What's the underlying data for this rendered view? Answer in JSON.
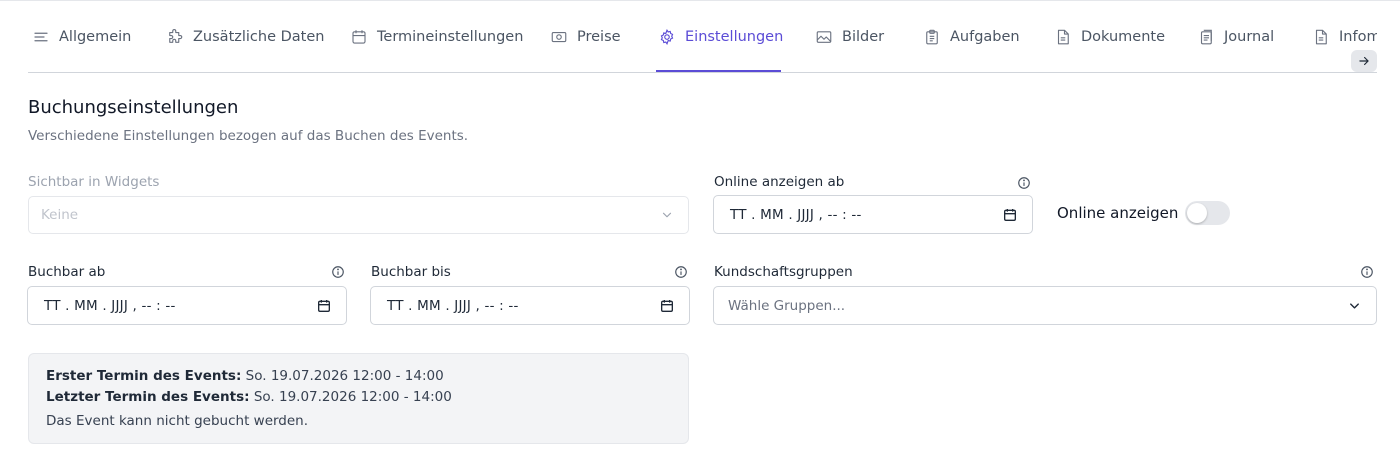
{
  "tabs": [
    {
      "label": "Allgemein",
      "icon": "menu-lines-icon"
    },
    {
      "label": "Zusätzliche Daten",
      "icon": "puzzle-icon"
    },
    {
      "label": "Termineinstellungen",
      "icon": "calendar-icon"
    },
    {
      "label": "Preise",
      "icon": "banknote-icon"
    },
    {
      "label": "Einstellungen",
      "icon": "gear-icon",
      "active": true
    },
    {
      "label": "Bilder",
      "icon": "image-icon"
    },
    {
      "label": "Aufgaben",
      "icon": "clipboard-icon"
    },
    {
      "label": "Dokumente",
      "icon": "document-icon"
    },
    {
      "label": "Journal",
      "icon": "journal-icon"
    },
    {
      "label": "Infom",
      "icon": "info-document-icon"
    }
  ],
  "colors": {
    "accent": "#5b4cd6",
    "infobox_bg": "#f3f4f6"
  },
  "section": {
    "title": "Buchungseinstellungen",
    "subtitle": "Verschiedene Einstellungen bezogen auf das Buchen des Events."
  },
  "fields": {
    "widgets": {
      "label": "Sichtbar in Widgets",
      "placeholder": "Keine"
    },
    "online_from": {
      "label": "Online anzeigen ab",
      "value": "TT . MM . JJJJ ,  -- : --"
    },
    "online_toggle": {
      "label": "Online anzeigen",
      "checked": false
    },
    "bookable_from": {
      "label": "Buchbar ab",
      "value": "TT . MM . JJJJ ,  -- : --"
    },
    "bookable_until": {
      "label": "Buchbar bis",
      "value": "TT . MM . JJJJ ,  -- : --"
    },
    "customer_groups": {
      "label": "Kundschaftsgruppen",
      "placeholder": "Wähle Gruppen..."
    }
  },
  "info": {
    "first_label": "Erster Termin des Events:",
    "first_value": "So. 19.07.2026 12:00 - 14:00",
    "last_label": "Letzter Termin des Events:",
    "last_value": "So. 19.07.2026 12:00 - 14:00",
    "note": "Das Event kann nicht gebucht werden."
  }
}
